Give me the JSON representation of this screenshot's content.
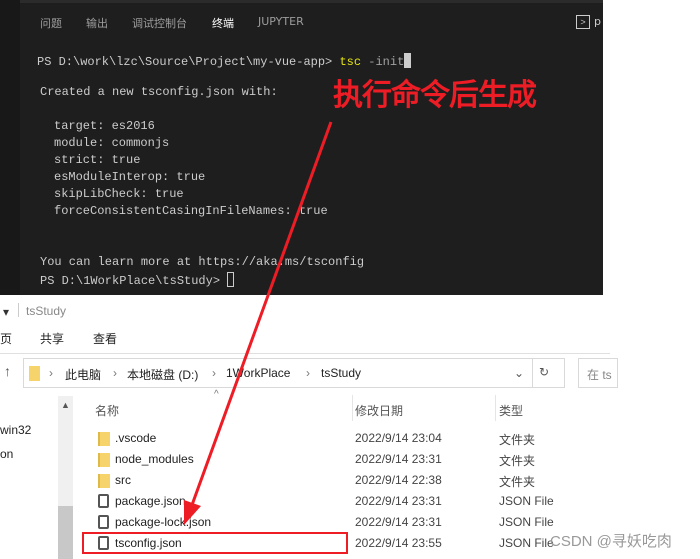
{
  "terminal": {
    "tabs": [
      "问题",
      "输出",
      "调试控制台",
      "终端",
      "JUPYTER"
    ],
    "active_tab": "终端",
    "shell_label": "p",
    "prompt1": "PS D:\\work\\lzc\\Source\\Project\\my-vue-app> ",
    "cmd": "tsc",
    "cmd_arg": " -init",
    "created": "Created a new tsconfig.json with:",
    "options": [
      "target: es2016",
      "module: commonjs",
      "strict: true",
      "esModuleInterop: true",
      "skipLibCheck: true",
      "forceConsistentCasingInFileNames: true"
    ],
    "learn": "You can learn more at https://aka.ms/tsconfig",
    "prompt2": "PS D:\\1WorkPlace\\tsStudy> "
  },
  "annotation": {
    "text": "执行命令后生成",
    "color": "#ee1c25"
  },
  "explorer": {
    "title": "tsStudy",
    "ribbon": [
      "页",
      "共享",
      "查看"
    ],
    "breadcrumb": [
      "此电脑",
      "本地磁盘 (D:)",
      "1WorkPlace",
      "tsStudy"
    ],
    "search_placeholder": "在 ts",
    "nav_items": [
      "win32",
      "on"
    ],
    "columns": {
      "name": "名称",
      "date": "修改日期",
      "type": "类型"
    },
    "files": [
      {
        "name": ".vscode",
        "date": "2022/9/14 23:04",
        "type": "文件夹",
        "icon": "folder"
      },
      {
        "name": "node_modules",
        "date": "2022/9/14 23:31",
        "type": "文件夹",
        "icon": "folder"
      },
      {
        "name": "src",
        "date": "2022/9/14 22:38",
        "type": "文件夹",
        "icon": "folder"
      },
      {
        "name": "package.json",
        "date": "2022/9/14 23:31",
        "type": "JSON File",
        "icon": "file"
      },
      {
        "name": "package-lock.json",
        "date": "2022/9/14 23:31",
        "type": "JSON File",
        "icon": "file"
      },
      {
        "name": "tsconfig.json",
        "date": "2022/9/14 23:55",
        "type": "JSON File",
        "icon": "file"
      }
    ],
    "highlighted": "tsconfig.json"
  },
  "watermark": "CSDN @寻妖吃肉"
}
